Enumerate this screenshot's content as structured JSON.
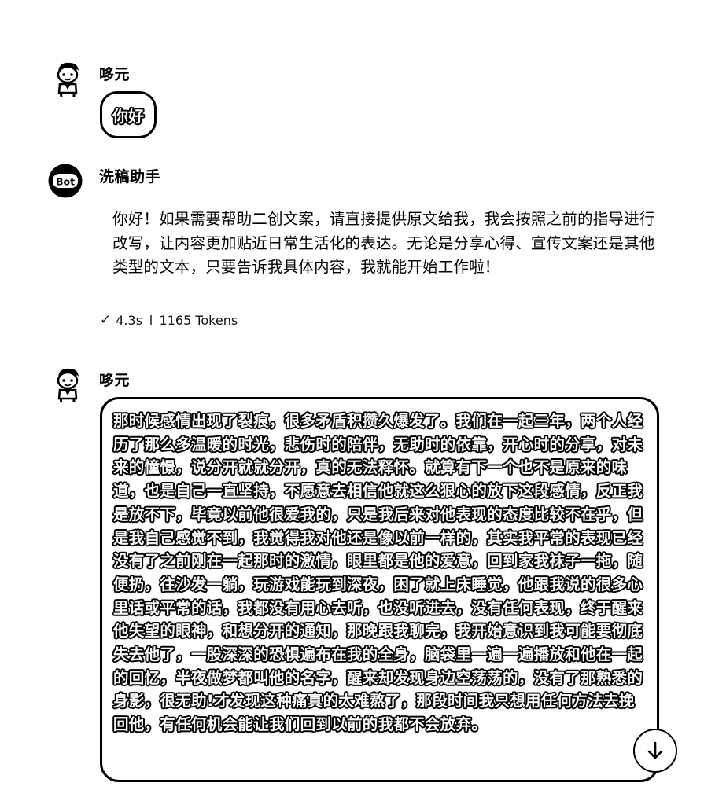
{
  "messages": [
    {
      "sender": "哆元",
      "avatar_icon": "cartoon-boy-avatar-icon",
      "text": "你好"
    },
    {
      "sender": "洗稿助手",
      "avatar_icon": "bot-avatar-icon",
      "avatar_label": "Bot",
      "text": "你好！如果需要帮助二创文案，请直接提供原文给我，我会按照之前的指导进行改写，让内容更加贴近日常生活化的表达。无论是分享心得、宣传文案还是其他类型的文本，只要告诉我具体内容，我就能开始工作啦！",
      "meta": {
        "status_icon": "check-icon",
        "duration": "4.3s",
        "tokens": "1165 Tokens"
      }
    },
    {
      "sender": "哆元",
      "avatar_icon": "cartoon-boy-avatar-icon",
      "text": "那时候感情出现了裂痕，很多矛盾积攒久爆发了。我们在一起三年，两个人经历了那么多温暖的时光，悲伤时的陪伴，无助时的依靠，开心时的分享，对未来的憧憬，说分开就就分开，真的无法释怀。就算有下一个也不是原来的味道，也是自己一直坚持，不愿意去相信他就这么狠心的放下这段感情，反正我是放不下，毕竟以前他很爱我的，只是我后来对他表现的态度比较不在乎，但是我自己感觉不到，我觉得我对他还是像以前一样的，其实我平常的表现已经没有了之前刚在一起那时的激情，眼里都是他的爱意，回到家我袜子一拖，随便扔，往沙发一躺，玩游戏能玩到深夜，困了就上床睡觉，他跟我说的很多心里话或平常的话，我都没有用心去听，也没听进去，没有任何表现，终于醒来他失望的眼神，和想分开的通知，那晚跟我聊完，我开始意识到我可能要彻底失去他了，一股深深的恐惧遍布在我的全身，脑袋里一遍一遍播放和他在一起的回忆，半夜做梦都叫他的名字，醒来却发现身边空荡荡的，没有了那熟悉的身影，很无助!才发现这种痛真的太难熬了，那段时间我只想用任何方法去挽回他，有任何机会能让我们回到以前的我都不会放弃。"
    }
  ],
  "scroll_button_icon": "arrow-down-icon"
}
